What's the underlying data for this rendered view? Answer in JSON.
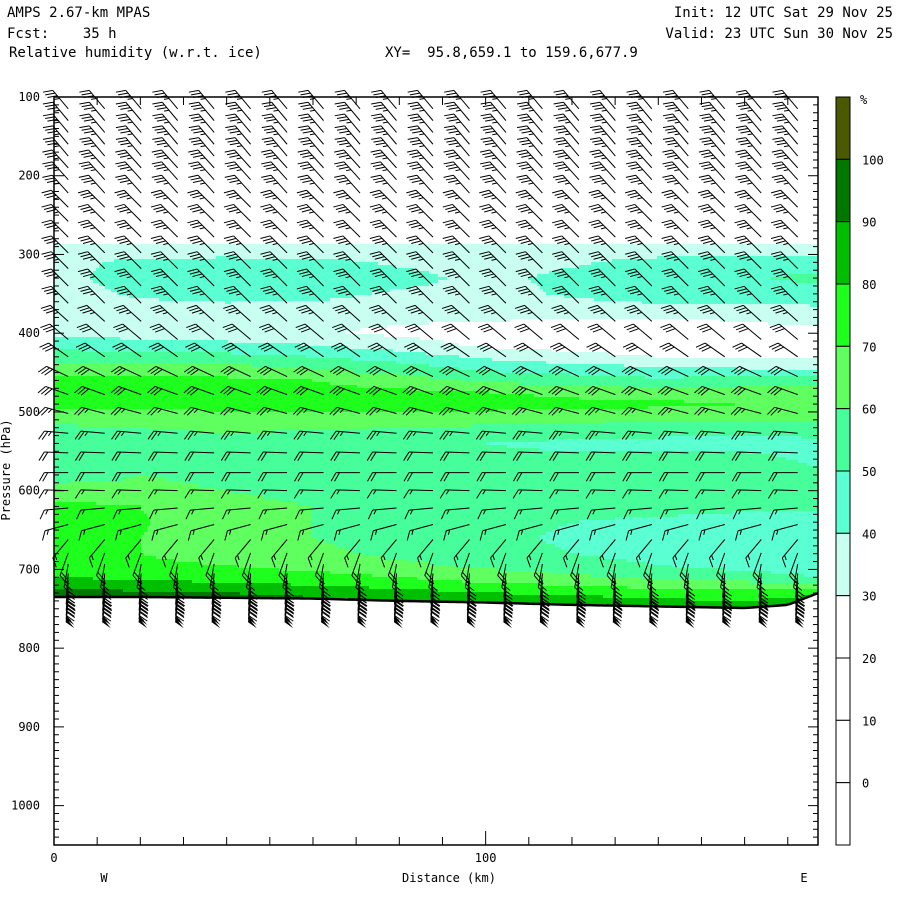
{
  "header": {
    "model": "AMPS 2.67-km MPAS",
    "forecast": "Fcst:    35 h",
    "field": "Relative humidity (w.r.t. ice)",
    "xy": "XY=  95.8,659.1 to 159.6,677.9",
    "init": "Init: 12 UTC Sat 29 Nov 25",
    "valid": "Valid: 23 UTC Sun 30 Nov 25"
  },
  "chart_data": {
    "type": "heatmap",
    "title": "Relative humidity (w.r.t. ice)",
    "xlabel": "Distance (km)",
    "ylabel": "Pressure (hPa)",
    "xlim": [
      0,
      177
    ],
    "ylim": [
      1050,
      100
    ],
    "x_ticks": [
      {
        "value": 0,
        "label": "0"
      },
      {
        "value": 100,
        "label": "100"
      }
    ],
    "y_ticks": [
      {
        "value": 100,
        "label": "100"
      },
      {
        "value": 200,
        "label": "200"
      },
      {
        "value": 300,
        "label": "300"
      },
      {
        "value": 400,
        "label": "400"
      },
      {
        "value": 500,
        "label": "500"
      },
      {
        "value": 600,
        "label": "600"
      },
      {
        "value": 700,
        "label": "700"
      },
      {
        "value": 800,
        "label": "800"
      },
      {
        "value": 900,
        "label": "900"
      },
      {
        "value": 1000,
        "label": "1000"
      }
    ],
    "end_labels": {
      "left": "W",
      "right": "E"
    },
    "colorbar": {
      "unit": "%",
      "labels": [
        "100",
        "90",
        "80",
        "70",
        "60",
        "50",
        "40",
        "30",
        "20",
        "10",
        "0"
      ],
      "colors": [
        "#4b5a00",
        "#007800",
        "#00be00",
        "#1eff1e",
        "#5fff5f",
        "#46ff9b",
        "#5affd2",
        "#c8fff0",
        "#ffffff",
        "#ffffff",
        "#ffffff",
        "#ffffff"
      ]
    },
    "rh_grid": {
      "distance_km": [
        0,
        20,
        40,
        60,
        80,
        100,
        120,
        140,
        160,
        177
      ],
      "pressure_hpa": [
        100,
        250,
        280,
        295,
        310,
        330,
        350,
        370,
        385,
        400,
        415,
        430,
        445,
        460,
        475,
        490,
        505,
        520,
        540,
        560,
        580,
        600,
        620,
        640,
        660,
        680,
        695,
        710,
        720,
        730,
        740,
        760
      ],
      "values": [
        [
          15,
          15,
          15,
          15,
          15,
          15,
          15,
          15,
          15,
          15
        ],
        [
          22,
          22,
          22,
          22,
          22,
          22,
          22,
          22,
          22,
          22
        ],
        [
          27,
          27,
          27,
          27,
          27,
          27,
          27,
          27,
          27,
          27
        ],
        [
          33,
          33,
          33,
          33,
          33,
          33,
          33,
          33,
          33,
          33
        ],
        [
          35,
          44,
          45,
          44,
          38,
          33,
          38,
          45,
          45,
          46
        ],
        [
          36,
          46,
          47,
          47,
          45,
          36,
          44,
          48,
          49,
          52
        ],
        [
          34,
          42,
          45,
          44,
          38,
          35,
          42,
          46,
          46,
          46
        ],
        [
          33,
          35,
          36,
          35,
          34,
          33,
          34,
          36,
          37,
          38
        ],
        [
          34,
          33,
          33,
          32,
          31,
          30,
          29,
          28,
          30,
          33
        ],
        [
          38,
          35,
          33,
          31,
          28,
          25,
          24,
          25,
          25,
          26
        ],
        [
          46,
          45,
          43,
          40,
          35,
          28,
          26,
          25,
          24,
          24
        ],
        [
          55,
          55,
          53,
          50,
          45,
          38,
          33,
          30,
          29,
          28
        ],
        [
          64,
          65,
          64,
          60,
          55,
          48,
          45,
          42,
          40,
          38
        ],
        [
          75,
          73,
          72,
          70,
          65,
          58,
          55,
          52,
          55,
          55
        ],
        [
          78,
          74,
          74,
          73,
          72,
          70,
          68,
          65,
          65,
          65
        ],
        [
          72,
          72,
          73,
          73,
          74,
          74,
          72,
          72,
          70,
          70
        ],
        [
          66,
          67,
          68,
          68,
          68,
          67,
          66,
          65,
          64,
          63
        ],
        [
          58,
          60,
          62,
          61,
          60,
          58,
          56,
          55,
          54,
          54
        ],
        [
          55,
          56,
          56,
          55,
          53,
          50,
          48,
          47,
          46,
          48
        ],
        [
          52,
          55,
          56,
          55,
          54,
          52,
          52,
          54,
          53,
          48
        ],
        [
          55,
          60,
          58,
          57,
          55,
          55,
          55,
          60,
          56,
          52
        ],
        [
          65,
          62,
          60,
          58,
          56,
          55,
          56,
          58,
          55,
          52
        ],
        [
          73,
          70,
          62,
          60,
          58,
          55,
          55,
          55,
          52,
          50
        ],
        [
          74,
          71,
          63,
          60,
          57,
          54,
          50,
          47,
          46,
          50
        ],
        [
          73,
          70,
          64,
          60,
          57,
          53,
          48,
          45,
          44,
          48
        ],
        [
          72,
          70,
          66,
          62,
          58,
          55,
          50,
          46,
          44,
          46
        ],
        [
          74,
          72,
          70,
          66,
          62,
          58,
          55,
          50,
          46,
          44
        ],
        [
          80,
          78,
          76,
          74,
          70,
          65,
          62,
          58,
          55,
          50
        ],
        [
          86,
          84,
          82,
          80,
          76,
          72,
          70,
          66,
          65,
          62
        ],
        [
          95,
          92,
          90,
          88,
          85,
          80,
          78,
          75,
          73,
          78
        ],
        [
          102,
          100,
          95,
          92,
          90,
          88,
          85,
          82,
          80,
          85
        ],
        [
          102,
          102,
          100,
          98,
          96,
          95,
          94,
          92,
          92,
          95
        ]
      ]
    },
    "terrain": {
      "distance_km": [
        0,
        20,
        40,
        60,
        80,
        100,
        120,
        140,
        160,
        170,
        177
      ],
      "surface_pressure_hpa": [
        735,
        735,
        736,
        737,
        740,
        742,
        745,
        747,
        749,
        745,
        730
      ]
    },
    "wind_barbs": {
      "distance_km": [
        3.3,
        11.75,
        20.2,
        28.65,
        37.1,
        45.55,
        54.0,
        62.45,
        70.9,
        79.35,
        87.8,
        96.25,
        104.7,
        113.15,
        121.6,
        130.05,
        138.5,
        146.95,
        155.4,
        163.85,
        172.3
      ],
      "levels": [
        {
          "p": 115,
          "dir": 320,
          "kt": 35
        },
        {
          "p": 130,
          "dir": 320,
          "kt": 35
        },
        {
          "p": 145,
          "dir": 320,
          "kt": 35
        },
        {
          "p": 160,
          "dir": 320,
          "kt": 35
        },
        {
          "p": 175,
          "dir": 320,
          "kt": 35
        },
        {
          "p": 190,
          "dir": 318,
          "kt": 35
        },
        {
          "p": 205,
          "dir": 318,
          "kt": 35
        },
        {
          "p": 222,
          "dir": 318,
          "kt": 35
        },
        {
          "p": 240,
          "dir": 315,
          "kt": 35
        },
        {
          "p": 258,
          "dir": 315,
          "kt": 35
        },
        {
          "p": 278,
          "dir": 315,
          "kt": 35
        },
        {
          "p": 298,
          "dir": 315,
          "kt": 35
        },
        {
          "p": 318,
          "dir": 315,
          "kt": 35
        },
        {
          "p": 340,
          "dir": 315,
          "kt": 35
        },
        {
          "p": 362,
          "dir": 315,
          "kt": 35
        },
        {
          "p": 385,
          "dir": 312,
          "kt": 35
        },
        {
          "p": 408,
          "dir": 310,
          "kt": 30
        },
        {
          "p": 430,
          "dir": 305,
          "kt": 30
        },
        {
          "p": 455,
          "dir": 295,
          "kt": 30
        },
        {
          "p": 478,
          "dir": 290,
          "kt": 30
        },
        {
          "p": 502,
          "dir": 285,
          "kt": 25
        },
        {
          "p": 527,
          "dir": 275,
          "kt": 25
        },
        {
          "p": 552,
          "dir": 272,
          "kt": 20
        },
        {
          "p": 577,
          "dir": 270,
          "kt": 20
        },
        {
          "p": 600,
          "dir": 272,
          "kt": 15
        },
        {
          "p": 622,
          "dir": 265,
          "kt": 15
        },
        {
          "p": 643,
          "dir": 255,
          "kt": 15
        },
        {
          "p": 662,
          "dir": 220,
          "kt": 15
        },
        {
          "p": 679,
          "dir": 200,
          "kt": 20
        },
        {
          "p": 693,
          "dir": 190,
          "kt": 25
        },
        {
          "p": 705,
          "dir": 185,
          "kt": 30
        },
        {
          "p": 714,
          "dir": 185,
          "kt": 35
        },
        {
          "p": 722,
          "dir": 185,
          "kt": 40
        },
        {
          "p": 728,
          "dir": 185,
          "kt": 45
        },
        {
          "p": 733,
          "dir": 185,
          "kt": 50
        },
        {
          "p": 737,
          "dir": 185,
          "kt": 55
        }
      ]
    }
  }
}
